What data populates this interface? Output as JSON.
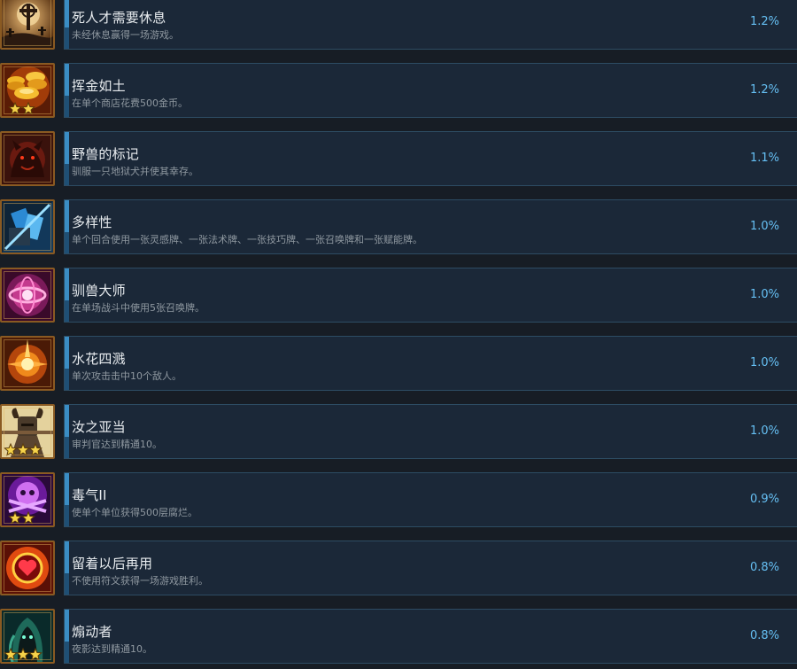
{
  "achievements": [
    {
      "title": "死人才需要休息",
      "desc": "未经休息赢得一场游戏。",
      "pct": "1.2%",
      "icon": "graveyard-cross-icon",
      "stars": 0
    },
    {
      "title": "挥金如土",
      "desc": "在单个商店花费500金币。",
      "pct": "1.2%",
      "icon": "gold-coins-icon",
      "stars": 2
    },
    {
      "title": "野兽的标记",
      "desc": "驯服一只地狱犬并使其幸存。",
      "pct": "1.1%",
      "icon": "hellhound-icon",
      "stars": 0
    },
    {
      "title": "多样性",
      "desc": "单个回合使用一张灵感牌、一张法术牌、一张技巧牌、一张召唤牌和一张赋能牌。",
      "pct": "1.0%",
      "icon": "blue-cards-icon",
      "stars": 0
    },
    {
      "title": "驯兽大师",
      "desc": "在单场战斗中使用5张召唤牌。",
      "pct": "1.0%",
      "icon": "pink-summon-icon",
      "stars": 0
    },
    {
      "title": "水花四溅",
      "desc": "单次攻击击中10个敌人。",
      "pct": "1.0%",
      "icon": "fire-burst-icon",
      "stars": 0
    },
    {
      "title": "汝之亚当",
      "desc": "审判官达到精通10。",
      "pct": "1.0%",
      "icon": "horned-knight-icon",
      "stars": 3
    },
    {
      "title": "毒气II",
      "desc": "使单个单位获得500层腐烂。",
      "pct": "0.9%",
      "icon": "poison-skull-icon",
      "stars": 2
    },
    {
      "title": "留着以后再用",
      "desc": "不使用符文获得一场游戏胜利。",
      "pct": "0.8%",
      "icon": "heart-rune-icon",
      "stars": 0
    },
    {
      "title": "煽动者",
      "desc": "夜影达到精通10。",
      "pct": "0.8%",
      "icon": "hooded-figure-icon",
      "stars": 3
    }
  ]
}
